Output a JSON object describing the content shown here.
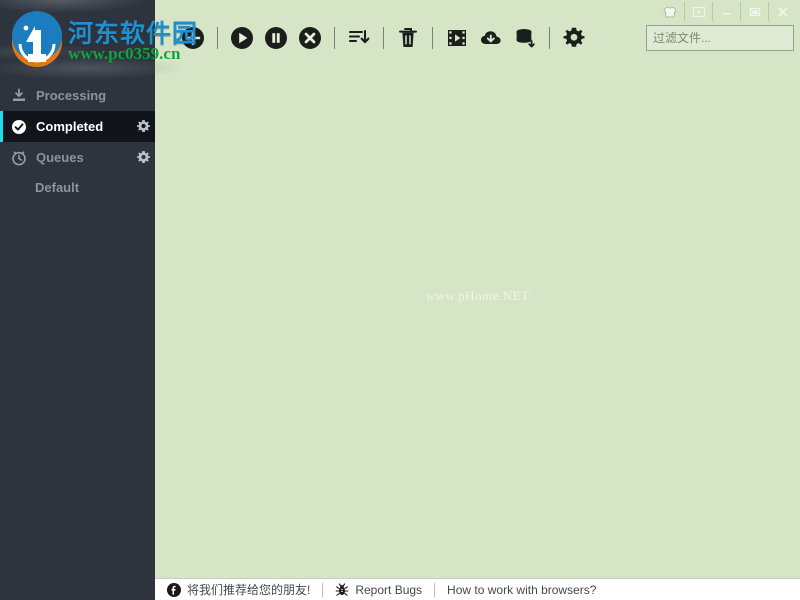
{
  "window": {
    "controls": [
      {
        "name": "skin-icon",
        "tooltip": "Skin"
      },
      {
        "name": "dropdown-icon",
        "tooltip": "Menu"
      },
      {
        "name": "minimize-icon",
        "tooltip": "Minimize"
      },
      {
        "name": "maximize-icon",
        "tooltip": "Maximize"
      },
      {
        "name": "close-icon",
        "tooltip": "Close"
      }
    ]
  },
  "search": {
    "placeholder": "过滤文件...",
    "value": "",
    "icon": "search-icon"
  },
  "toolbar": {
    "buttons": [
      {
        "name": "add-download-button",
        "icon": "plus-circle-icon"
      },
      {
        "name": "start-button",
        "icon": "play-icon"
      },
      {
        "name": "pause-button",
        "icon": "pause-icon"
      },
      {
        "name": "cancel-button",
        "icon": "cancel-icon"
      },
      {
        "name": "sort-button",
        "icon": "sort-descending-icon"
      },
      {
        "name": "delete-button",
        "icon": "trash-icon"
      },
      {
        "name": "media-grabber-button",
        "icon": "film-icon"
      },
      {
        "name": "cloud-download-button",
        "icon": "cloud-download-icon"
      },
      {
        "name": "storage-button",
        "icon": "database-down-icon"
      },
      {
        "name": "settings-button",
        "icon": "gear-icon"
      }
    ]
  },
  "sidebar": {
    "items": [
      {
        "label": "Processing",
        "icon": "download-tray-icon",
        "active": false,
        "gear": false
      },
      {
        "label": "Completed",
        "icon": "check-circle-icon",
        "active": true,
        "gear": true
      },
      {
        "label": "Queues",
        "icon": "clock-icon",
        "active": false,
        "gear": true
      }
    ],
    "sub_items": [
      {
        "label": "Default",
        "parent": "Queues"
      }
    ]
  },
  "content": {
    "watermark": "www.pHome.NET",
    "empty": true
  },
  "statusbar": {
    "items": [
      {
        "label": "将我们推荐给您的朋友!",
        "icon": "facebook-icon",
        "name": "recommend-link"
      },
      {
        "label": "Report Bugs",
        "icon": "bug-icon",
        "name": "report-bugs-link"
      },
      {
        "label": "How to work with browsers?",
        "icon": "none",
        "name": "browser-help-link"
      }
    ]
  },
  "site_watermark": {
    "title_cn": "河东软件园",
    "url": "www.pc0359.cn"
  },
  "colors": {
    "sidebar_bg": "#2e343d",
    "sidebar_active_bg": "#11141a",
    "accent": "#24d9e8",
    "content_bg": "#d6e5c6",
    "header_green": "#b9d3a0",
    "statusbar_bg": "#ffffff",
    "watermark_blue": "#1e8fd1",
    "watermark_green": "#12a33f"
  }
}
